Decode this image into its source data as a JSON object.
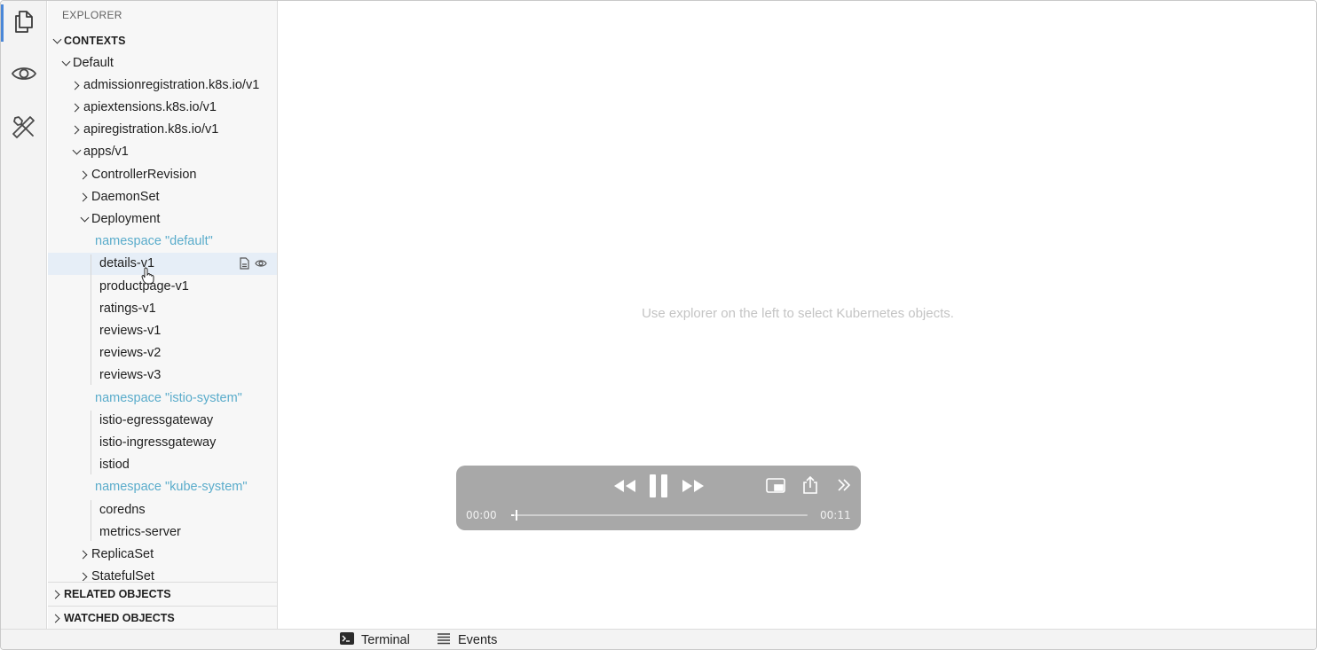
{
  "activity_bar": {
    "items": [
      {
        "name": "explorer",
        "icon": "files-icon",
        "active": true
      },
      {
        "name": "watch",
        "icon": "eye-icon",
        "active": false
      },
      {
        "name": "tools",
        "icon": "wrench-screwdriver-icon",
        "active": false
      }
    ]
  },
  "sidebar": {
    "title": "EXPLORER",
    "contexts_header": "CONTEXTS",
    "tree": [
      {
        "label": "Default",
        "depth": 1,
        "state": "expanded"
      },
      {
        "label": "admissionregistration.k8s.io/v1",
        "depth": 2,
        "state": "collapsed"
      },
      {
        "label": "apiextensions.k8s.io/v1",
        "depth": 2,
        "state": "collapsed"
      },
      {
        "label": "apiregistration.k8s.io/v1",
        "depth": 2,
        "state": "collapsed"
      },
      {
        "label": "apps/v1",
        "depth": 2,
        "state": "expanded"
      },
      {
        "label": "ControllerRevision",
        "depth": 3,
        "state": "collapsed"
      },
      {
        "label": "DaemonSet",
        "depth": 3,
        "state": "collapsed"
      },
      {
        "label": "Deployment",
        "depth": 3,
        "state": "expanded"
      },
      {
        "label": "namespace \"default\"",
        "depth": 4,
        "state": "namespace"
      },
      {
        "label": "details-v1",
        "depth": 5,
        "state": "leaf",
        "selected": true
      },
      {
        "label": "productpage-v1",
        "depth": 5,
        "state": "leaf"
      },
      {
        "label": "ratings-v1",
        "depth": 5,
        "state": "leaf"
      },
      {
        "label": "reviews-v1",
        "depth": 5,
        "state": "leaf"
      },
      {
        "label": "reviews-v2",
        "depth": 5,
        "state": "leaf"
      },
      {
        "label": "reviews-v3",
        "depth": 5,
        "state": "leaf"
      },
      {
        "label": "namespace \"istio-system\"",
        "depth": 4,
        "state": "namespace"
      },
      {
        "label": "istio-egressgateway",
        "depth": 5,
        "state": "leaf"
      },
      {
        "label": "istio-ingressgateway",
        "depth": 5,
        "state": "leaf"
      },
      {
        "label": "istiod",
        "depth": 5,
        "state": "leaf"
      },
      {
        "label": "namespace \"kube-system\"",
        "depth": 4,
        "state": "namespace"
      },
      {
        "label": "coredns",
        "depth": 5,
        "state": "leaf"
      },
      {
        "label": "metrics-server",
        "depth": 5,
        "state": "leaf"
      },
      {
        "label": "ReplicaSet",
        "depth": 3,
        "state": "collapsed"
      },
      {
        "label": "StatefulSet",
        "depth": 3,
        "state": "collapsed"
      }
    ],
    "selected_row_actions": [
      "file-icon",
      "eye-icon"
    ],
    "related_objects_header": "RELATED OBJECTS",
    "watched_objects_header": "WATCHED OBJECTS"
  },
  "main": {
    "placeholder": "Use explorer on the left to select Kubernetes objects."
  },
  "bottom_bar": {
    "tabs": [
      {
        "label": "Terminal",
        "icon": "terminal-icon"
      },
      {
        "label": "Events",
        "icon": "list-icon"
      }
    ]
  },
  "video_player": {
    "current_time": "00:00",
    "remaining_time": "00:11",
    "progress": 0.01,
    "state": "playing"
  }
}
